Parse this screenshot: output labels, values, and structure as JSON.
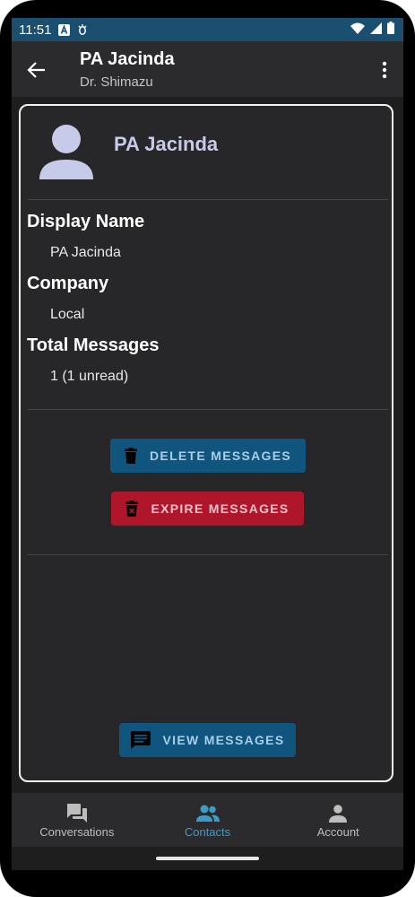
{
  "status_bar": {
    "time": "11:51",
    "icons": [
      "a-badge-icon",
      "bug-icon",
      "wifi-icon",
      "signal-icon",
      "battery-icon"
    ]
  },
  "app_bar": {
    "title": "PA Jacinda",
    "subtitle": "Dr. Shimazu",
    "back_icon": "arrow-back-icon",
    "menu_icon": "more-vert-icon"
  },
  "contact": {
    "name": "PA Jacinda",
    "fields": [
      {
        "label": "Display Name",
        "value": "PA Jacinda"
      },
      {
        "label": "Company",
        "value": "Local"
      },
      {
        "label": "Total Messages",
        "value": "1 (1 unread)"
      }
    ]
  },
  "actions": {
    "delete_label": "DELETE MESSAGES",
    "expire_label": "EXPIRE MESSAGES",
    "view_label": "VIEW MESSAGES"
  },
  "bottom_nav": {
    "items": [
      {
        "label": "Conversations",
        "icon": "forum-icon",
        "active": false
      },
      {
        "label": "Contacts",
        "icon": "people-icon",
        "active": true
      },
      {
        "label": "Account",
        "icon": "person-icon",
        "active": false
      }
    ]
  },
  "colors": {
    "status_bar": "#1a4f70",
    "primary_button": "#10557d",
    "danger_button": "#b0162b",
    "accent": "#3a9dc9",
    "avatar": "#c7cbe9"
  }
}
